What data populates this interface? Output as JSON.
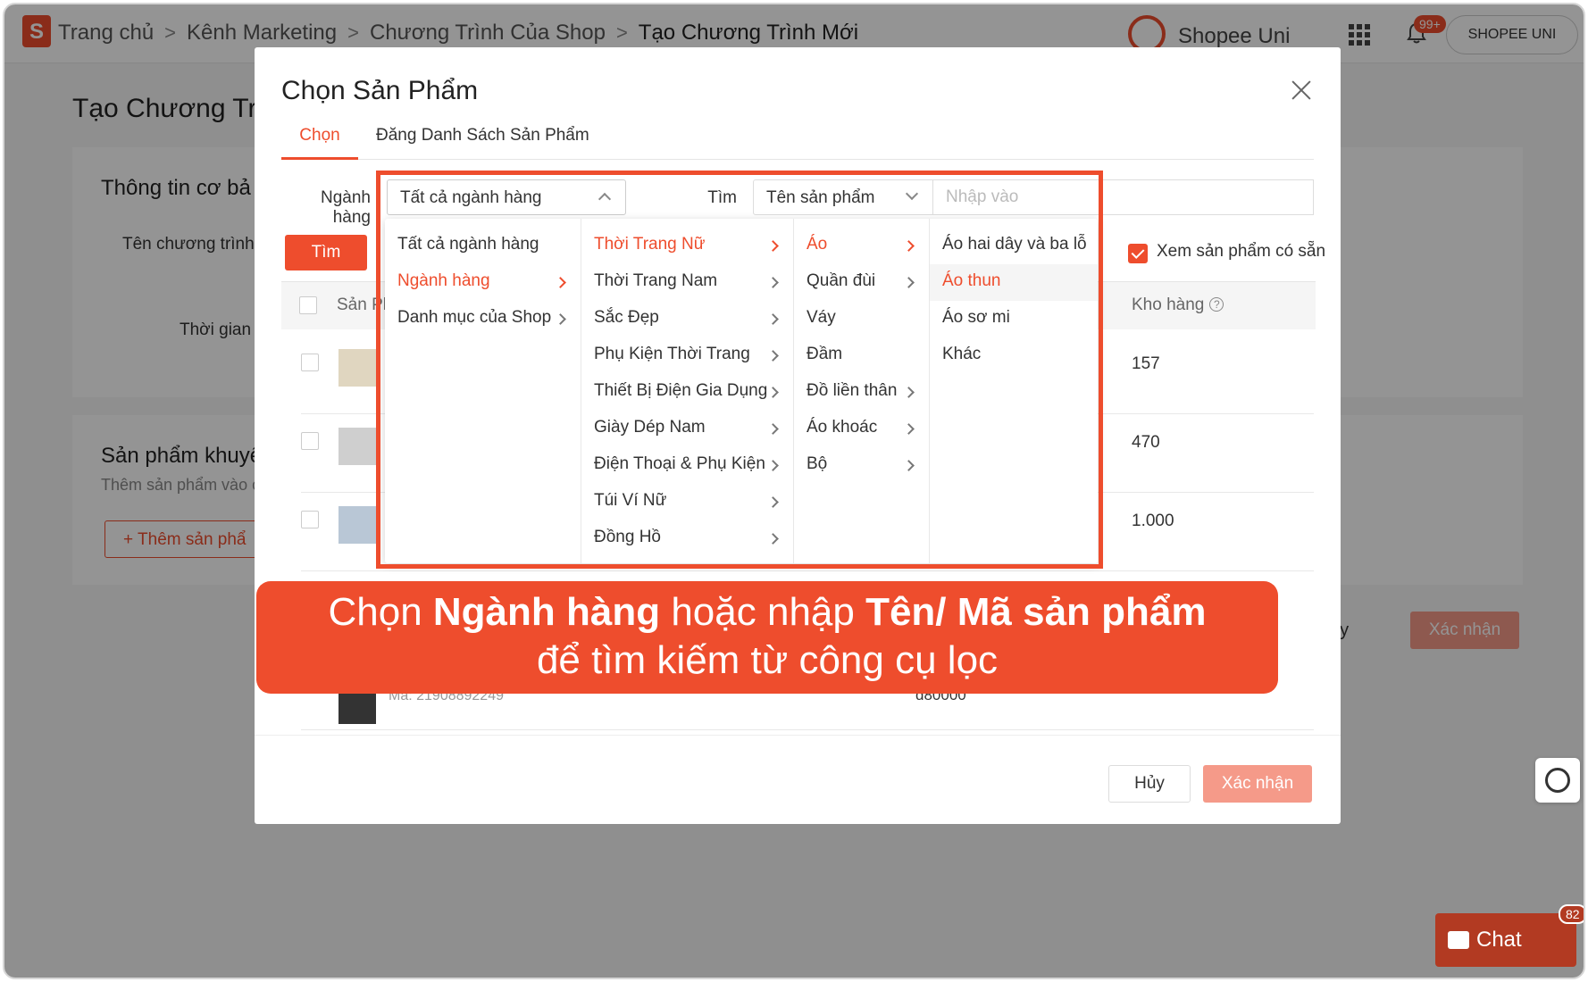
{
  "header": {
    "logo_letter": "S",
    "breadcrumbs": [
      "Trang chủ",
      "Kênh Marketing",
      "Chương Trình Của Shop",
      "Tạo Chương Trình Mới"
    ],
    "brand": "Shopee Uni",
    "notification_badge": "99+",
    "account": "SHOPEE UNI"
  },
  "background_page": {
    "title": "Tạo Chương Trì",
    "basic_info_title": "Thông tin cơ bả",
    "program_name_label": "Tên chương trình",
    "time_label": "Thời gian",
    "products_title": "Sản phẩm khuyế",
    "products_sub": "Thêm sản phẩm vào c",
    "add_product": "Thêm sản phẩ",
    "cancel_partial": "ủy",
    "confirm": "Xác nhận"
  },
  "modal": {
    "title": "Chọn Sản Phẩm",
    "tabs": [
      {
        "label": "Chọn",
        "active": true
      },
      {
        "label": "Đăng Danh Sách Sản Phẩm",
        "active": false
      }
    ],
    "filter": {
      "industry_label_line1": "Ngành",
      "industry_label_line2": "hàng",
      "industry_value": "Tất cả ngành hàng",
      "search_label": "Tìm",
      "search_field": "Tên sản phẩm",
      "search_placeholder": "Nhập vào",
      "search_button": "Tìm",
      "available_only_label": "Xem sản phẩm có sẵn",
      "available_only_checked": true
    },
    "table": {
      "header_product": "Sản Ph",
      "header_stock": "Kho hàng",
      "rows": [
        {
          "stock": "157"
        },
        {
          "stock": "470"
        },
        {
          "stock": "1.000"
        }
      ],
      "partial_code": "Mã: 21908892249",
      "partial_price": "đ80000"
    },
    "cancel_button": "Hủy",
    "confirm_button": "Xác nhận"
  },
  "cascade": {
    "col1": [
      {
        "label": "Tất cả ngành hàng",
        "arrow": false,
        "active": false
      },
      {
        "label": "Ngành hàng",
        "arrow": true,
        "active": true
      },
      {
        "label": "Danh mục của Shop",
        "arrow": true,
        "active": false
      }
    ],
    "col2": [
      {
        "label": "Thời Trang Nữ",
        "active": true
      },
      {
        "label": "Thời Trang Nam"
      },
      {
        "label": "Sắc Đẹp"
      },
      {
        "label": "Phụ Kiện Thời Trang"
      },
      {
        "label": "Thiết Bị Điện Gia Dụng"
      },
      {
        "label": "Giày Dép Nam"
      },
      {
        "label": "Điện Thoại & Phụ Kiện"
      },
      {
        "label": "Túi Ví Nữ"
      },
      {
        "label": "Đồng Hồ"
      }
    ],
    "col3": [
      {
        "label": "Áo",
        "arrow": true,
        "active": true
      },
      {
        "label": "Quần đùi",
        "arrow": true
      },
      {
        "label": "Váy",
        "arrow": false
      },
      {
        "label": "Đầm",
        "arrow": false
      },
      {
        "label": "Đồ liền thân",
        "arrow": true
      },
      {
        "label": "Áo khoác",
        "arrow": true
      },
      {
        "label": "Bộ",
        "arrow": true
      }
    ],
    "col4": [
      {
        "label": "Áo hai dây và ba lỗ"
      },
      {
        "label": "Áo thun",
        "active": true
      },
      {
        "label": "Áo sơ mi"
      },
      {
        "label": "Khác"
      }
    ]
  },
  "callout": {
    "l1_a": "Chọn ",
    "l1_b": "Ngành hàng",
    "l1_c": " hoặc nhập ",
    "l1_d": "Tên/ Mã sản phẩm",
    "l2": "để tìm kiếm từ công cụ lọc"
  },
  "chat": {
    "label": "Chat",
    "badge": "82"
  },
  "colors": {
    "accent": "#ee4d2d",
    "accent_disabled": "#f59a89",
    "chat": "#b23a22"
  }
}
